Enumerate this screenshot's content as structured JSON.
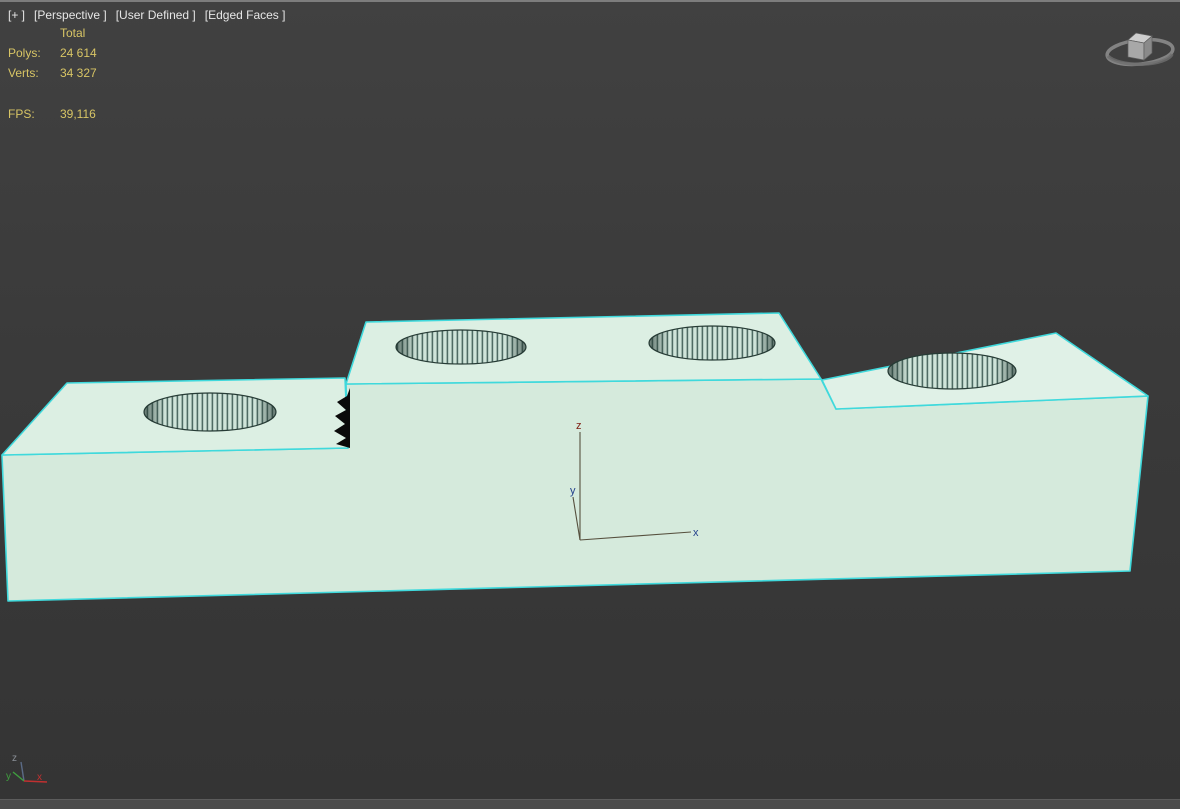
{
  "viewport_header": {
    "menu_general": "[+ ]",
    "menu_pov": "[Perspective ]",
    "menu_user": "[User Defined ]",
    "menu_shading": "[Edged Faces ]"
  },
  "statistics": {
    "header": "Total",
    "polys_label": "Polys:",
    "polys_value": "24 614",
    "verts_label": "Verts:",
    "verts_value": "34 327",
    "fps_label": "FPS:",
    "fps_value": "39,116"
  },
  "axis_tripod": {
    "x_label": "x",
    "y_label": "y",
    "z_label": "z"
  },
  "world_axis": {
    "x_label": "x",
    "y_label": "y",
    "z_label": "z"
  },
  "colors": {
    "background": "#3a3a3a",
    "stats_text": "#d8c565",
    "header_text": "#e6e6e6",
    "selection_edge": "#3fd9dc",
    "model_top": "#dcefe3",
    "model_front": "#d5eadc",
    "model_right_top": "#e0f1e7",
    "hole_fill": "#cfe4d9",
    "hole_line": "#4e6b63",
    "hole_rim": "#263b35",
    "tripod_line": "#56503e",
    "tripod_z": "#7d1d12",
    "tripod_xy": "#24418c",
    "world_z": "#8a8f96",
    "world_y": "#3f9f3f",
    "world_x": "#c03030"
  }
}
